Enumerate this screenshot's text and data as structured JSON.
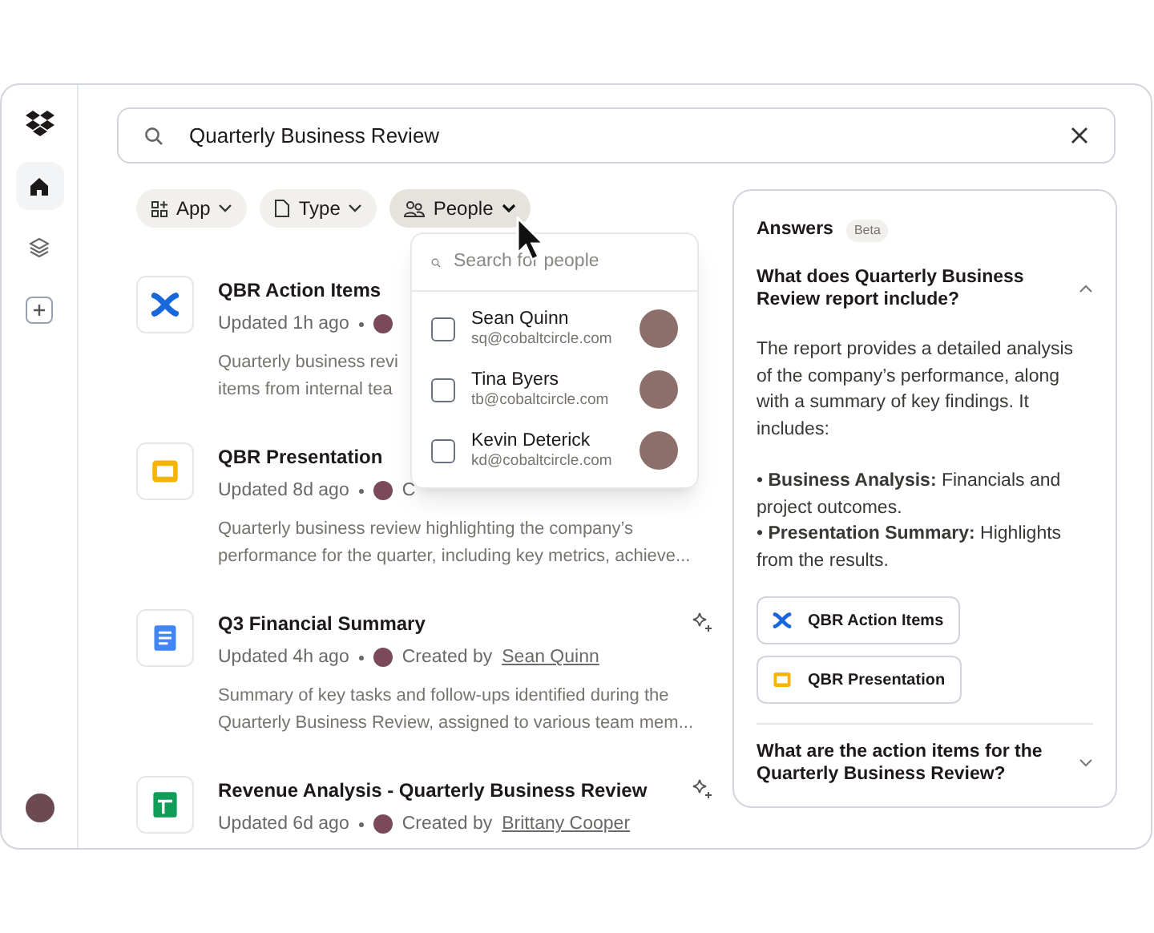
{
  "sidebar": {
    "items": [
      {
        "kind": "home",
        "selected": true
      },
      {
        "kind": "layers",
        "selected": false
      }
    ]
  },
  "search": {
    "value": "Quarterly Business Review"
  },
  "filters": [
    {
      "kind": "app",
      "label": "App",
      "open": false
    },
    {
      "kind": "type",
      "label": "Type",
      "open": false
    },
    {
      "kind": "people",
      "label": "People",
      "open": true
    }
  ],
  "people_menu": {
    "placeholder": "Search for people",
    "people": [
      {
        "name": "Sean Quinn",
        "email": "sq@cobaltcircle.com",
        "checked": false
      },
      {
        "name": "Tina Byers",
        "email": "tb@cobaltcircle.com",
        "checked": false
      },
      {
        "name": "Kevin Deterick",
        "email": "kd@cobaltcircle.com",
        "checked": false
      }
    ]
  },
  "results": [
    {
      "kind": "confluence",
      "title": "QBR Action Items",
      "updated": "Updated 1h ago",
      "sparkle": false,
      "description_lines": [
        "Quarterly business revi",
        "items from internal tea"
      ]
    },
    {
      "kind": "slides",
      "title": "QBR Presentation",
      "updated": "Updated 8d ago",
      "created_label": "C",
      "sparkle": false,
      "description_lines": [
        "Quarterly business review highlighting the company’s",
        "performance for the quarter, including key metrics, achieve..."
      ]
    },
    {
      "kind": "docs",
      "title": "Q3 Financial Summary",
      "updated": "Updated 4h ago",
      "created_label": "Created by",
      "creator": "Sean Quinn",
      "sparkle": true,
      "description_lines": [
        "Summary of key tasks and follow-ups identified during the",
        "Quarterly Business Review, assigned to various team mem..."
      ]
    },
    {
      "kind": "sheets",
      "title": "Revenue Analysis - Quarterly Business Review",
      "updated": "Updated 6d ago",
      "created_label": "Created by",
      "creator": "Brittany Cooper",
      "sparkle": true
    }
  ],
  "answers": {
    "title": "Answers",
    "badge": "Beta",
    "questions": [
      {
        "question": "What does Quarterly Business Review report include?",
        "expanded": true,
        "paragraphs": [
          "The report provides a detailed analysis of the company’s performance, along with a summary of key findings. It includes:",
          "• **Business Analysis:** Financials and project outcomes.\n• **Presentation Summary:** Highlights from the results."
        ],
        "sources": [
          {
            "kind": "confluence",
            "label": "QBR Action Items"
          },
          {
            "kind": "slides",
            "label": "QBR Presentation"
          }
        ]
      },
      {
        "question": "What are the action items for the Quarterly Business Review?",
        "expanded": false
      }
    ]
  }
}
